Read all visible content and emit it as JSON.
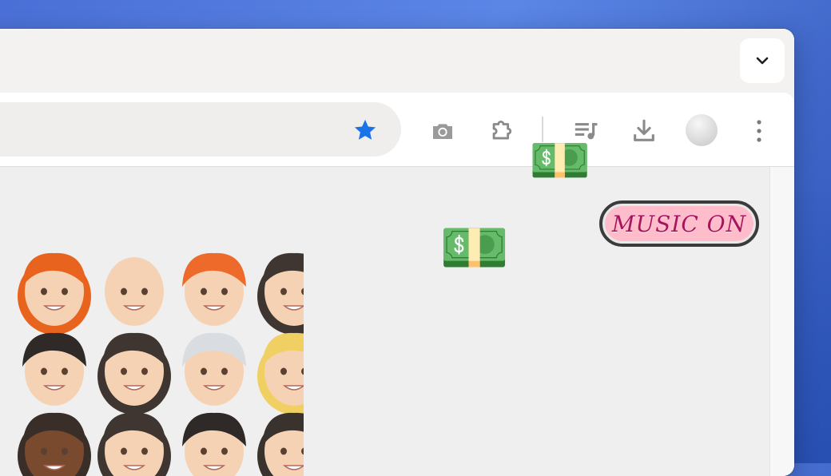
{
  "colors": {
    "desktop": "#4a6fd6",
    "chrome_frame": "#f3f2f1",
    "toolbar": "#ffffff",
    "omnibox": "#efeeed",
    "star_accent": "#1a73e8",
    "toolbar_icon": "#8a8a8a",
    "page_bg": "#efefef",
    "music_button_fill": "#ffbccb",
    "music_button_text": "#a8155f"
  },
  "icons": {
    "tab_dropdown": "chevron-down-icon",
    "bookmark": "star-icon",
    "screenshot": "camera-icon",
    "extensions": "puzzle-icon",
    "media": "playlist-music-icon",
    "downloads": "download-icon",
    "profile": "profile-avatar",
    "menu": "kebab-menu-icon"
  },
  "page": {
    "music_toggle_label": "MUSIC ON",
    "money_emoji": "💵",
    "avatar_grid": [
      [
        "ginger-woman-avatar",
        "bald-man-avatar",
        "redhead-man-avatar",
        "brunette-woman-avatar"
      ],
      [
        "dark-hair-man-avatar",
        "brunette-woman-avatar",
        "grey-hair-man-avatar",
        "blonde-woman-avatar"
      ],
      [
        "curly-dark-woman-avatar",
        "brunette-woman-avatar",
        "dark-hair-man-avatar",
        "curly-hair-woman-avatar"
      ]
    ]
  }
}
